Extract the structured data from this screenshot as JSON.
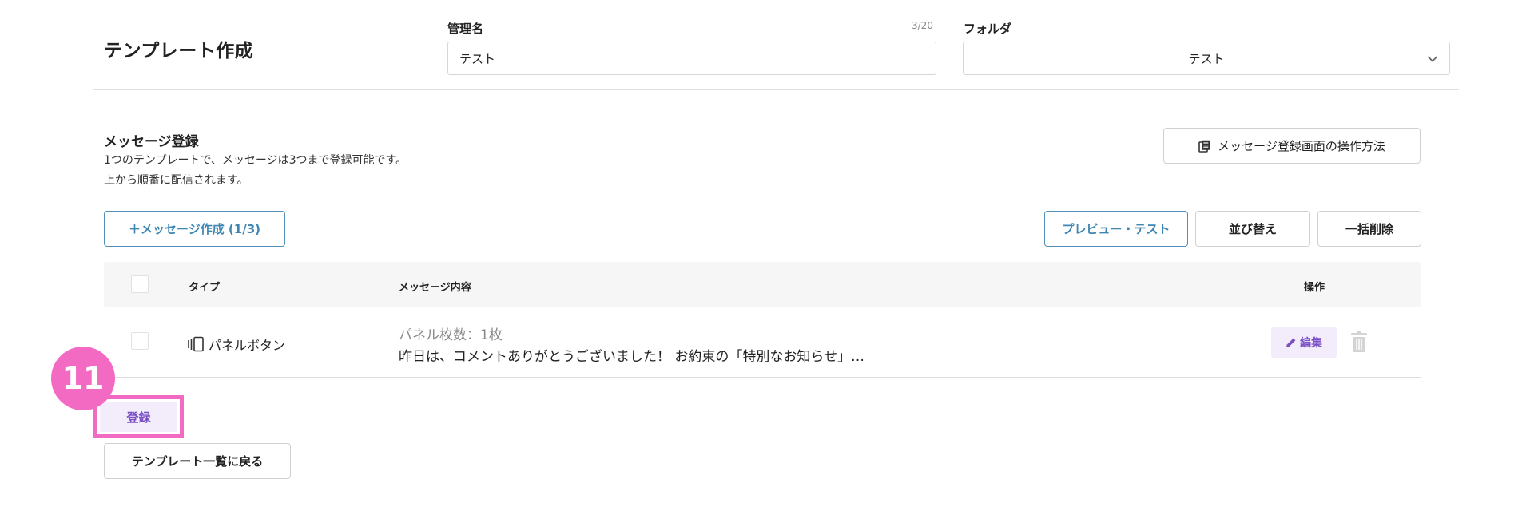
{
  "header": {
    "title": "テンプレート作成",
    "name_field": {
      "label": "管理名",
      "counter": "3/20",
      "value": "テスト"
    },
    "folder_field": {
      "label": "フォルダ",
      "value": "テスト",
      "icon": "chevron-down-icon"
    }
  },
  "message_section": {
    "title": "メッセージ登録",
    "desc_line1": "1つのテンプレートで、メッセージは3つまで登録可能です。",
    "desc_line2": "上から順番に配信されます。",
    "guide_button": "メッセージ登録画面の操作方法",
    "create_button": "＋メッセージ作成 (1/3)",
    "preview_button": "プレビュー・テスト",
    "sort_button": "並び替え",
    "bulk_delete_button": "一括削除"
  },
  "table": {
    "headers": {
      "type": "タイプ",
      "content": "メッセージ内容",
      "action": "操作"
    },
    "rows": [
      {
        "type": "パネルボタン",
        "content_sub": "パネル枚数：1枚",
        "content_main": "昨日は、コメントありがとうございました！ お約束の「特別なお知らせ」…",
        "edit_label": "編集"
      }
    ]
  },
  "footer": {
    "step_number": "11",
    "register_button": "登録",
    "back_button": "テンプレート一覧に戻る"
  },
  "colors": {
    "accent_pink": "#f36ac3",
    "accent_purple": "#7a4fc4",
    "accent_blue": "#3f86b3"
  }
}
